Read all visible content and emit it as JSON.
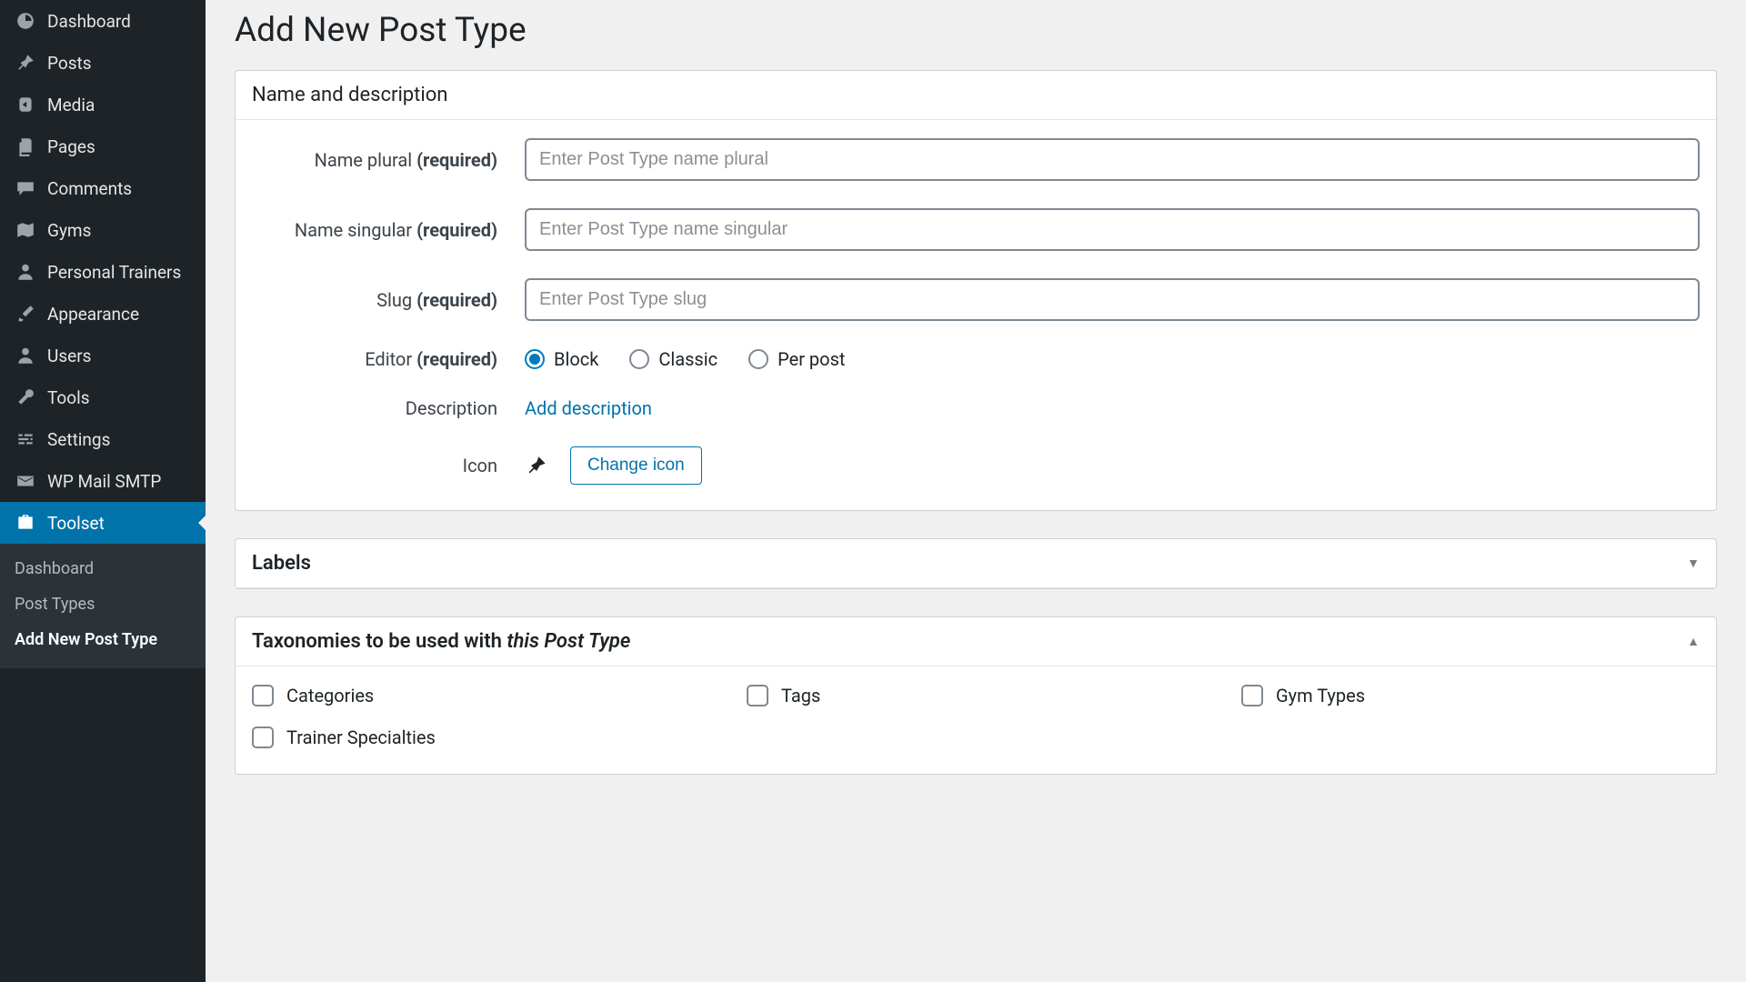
{
  "sidebar": {
    "items": [
      {
        "label": "Dashboard",
        "icon": "dashboard"
      },
      {
        "label": "Posts",
        "icon": "pin"
      },
      {
        "label": "Media",
        "icon": "media"
      },
      {
        "label": "Pages",
        "icon": "pages"
      },
      {
        "label": "Comments",
        "icon": "comments"
      },
      {
        "label": "Gyms",
        "icon": "map"
      },
      {
        "label": "Personal Trainers",
        "icon": "user"
      },
      {
        "label": "Appearance",
        "icon": "brush"
      },
      {
        "label": "Users",
        "icon": "user"
      },
      {
        "label": "Tools",
        "icon": "wrench"
      },
      {
        "label": "Settings",
        "icon": "sliders"
      },
      {
        "label": "WP Mail SMTP",
        "icon": "mail"
      },
      {
        "label": "Toolset",
        "icon": "briefcase",
        "active": true
      }
    ],
    "submenu": [
      {
        "label": "Dashboard"
      },
      {
        "label": "Post Types"
      },
      {
        "label": "Add New Post Type",
        "current": true
      }
    ]
  },
  "page": {
    "title": "Add New Post Type"
  },
  "panels": {
    "nameDesc": {
      "title": "Name and description",
      "fields": {
        "namePlural": {
          "label": "Name plural",
          "req": "(required)",
          "placeholder": "Enter Post Type name plural"
        },
        "nameSingular": {
          "label": "Name singular",
          "req": "(required)",
          "placeholder": "Enter Post Type name singular"
        },
        "slug": {
          "label": "Slug",
          "req": "(required)",
          "placeholder": "Enter Post Type slug"
        },
        "editor": {
          "label": "Editor",
          "req": "(required)",
          "options": [
            {
              "label": "Block",
              "checked": true
            },
            {
              "label": "Classic",
              "checked": false
            },
            {
              "label": "Per post",
              "checked": false
            }
          ]
        },
        "description": {
          "label": "Description",
          "link": "Add description"
        },
        "icon": {
          "label": "Icon",
          "button": "Change icon"
        }
      }
    },
    "labels": {
      "title": "Labels"
    },
    "taxonomies": {
      "title_prefix": "Taxonomies to be used with ",
      "title_italic": "this Post Type",
      "items": [
        {
          "label": "Categories"
        },
        {
          "label": "Tags"
        },
        {
          "label": "Gym Types"
        },
        {
          "label": "Trainer Specialties"
        }
      ]
    }
  }
}
